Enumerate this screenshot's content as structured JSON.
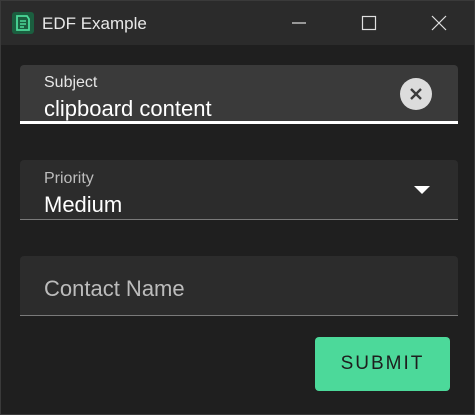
{
  "window": {
    "title": "EDF Example",
    "icon": "app-icon",
    "controls": [
      "minimize-icon",
      "maximize-icon",
      "close-icon"
    ]
  },
  "form": {
    "subject": {
      "label": "Subject",
      "value": "clipboard content"
    },
    "priority": {
      "label": "Priority",
      "value": "Medium"
    },
    "contact": {
      "placeholder": "Contact Name",
      "value": ""
    },
    "submit_label": "SUBMIT"
  },
  "colors": {
    "background": "#1f1f1f",
    "titlebar": "#2b2b2b",
    "field": "#2c2c2c",
    "field_active": "#3a3a3a",
    "accent": "#4cd99a"
  }
}
